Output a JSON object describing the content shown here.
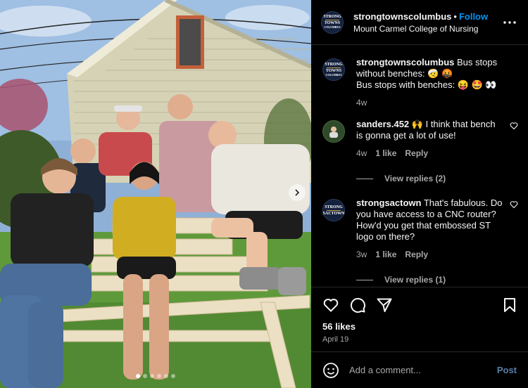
{
  "post": {
    "username": "strongtownscolumbus",
    "separator": "•",
    "follow_label": "Follow",
    "location": "Mount Carmel College of Nursing",
    "avatar_text": [
      "STRONG",
      "TOWNS",
      "COLUMBUS"
    ],
    "more_icon": "more-dots-icon"
  },
  "caption": {
    "username": "strongtownscolumbus",
    "line1": "Bus stops without benches: 🤕 🤬",
    "line2": "Bus stops with benches: 😝 🤩 👀",
    "time": "4w"
  },
  "comments": [
    {
      "username": "sanders.452",
      "text": "🙌 I think that bench is gonna get a lot of use!",
      "time": "4w",
      "likes": "1 like",
      "reply": "Reply",
      "view_replies": "View replies (2)"
    },
    {
      "username": "strongsactown",
      "text": "That's fabulous. Do you have access to a CNC router? How'd you get that embossed ST logo on there?",
      "time": "3w",
      "likes": "1 like",
      "reply": "Reply",
      "view_replies": "View replies (1)",
      "avatar_text": [
        "STRONG",
        "SACTOWN"
      ]
    }
  ],
  "actions": {
    "likes": "56 likes",
    "date": "April 19"
  },
  "add_comment": {
    "placeholder": "Add a comment...",
    "post_label": "Post"
  },
  "carousel": {
    "slides": 6,
    "active_index": 0
  },
  "colors": {
    "background": "#000000",
    "link_blue": "#0095f6",
    "muted": "#a8a8a8",
    "divider": "#262626"
  }
}
